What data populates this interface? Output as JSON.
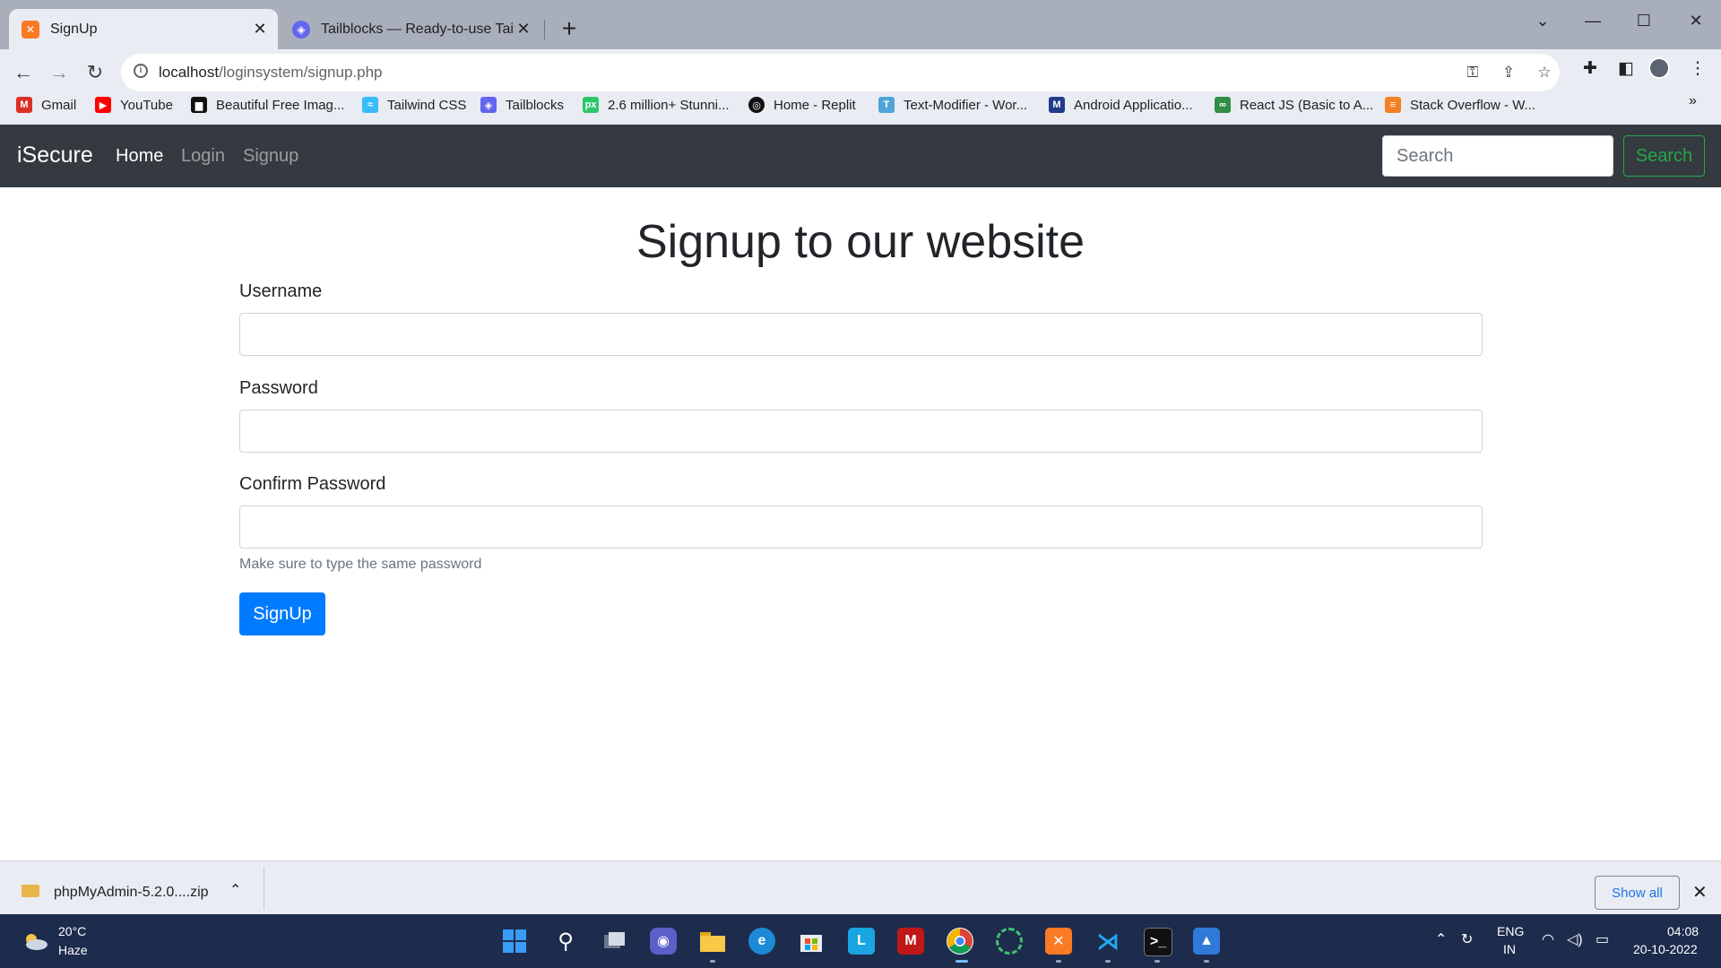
{
  "browser": {
    "tabs": [
      {
        "title": "SignUp",
        "active": true,
        "favicon": "xampp-icon"
      },
      {
        "title": "Tailblocks — Ready-to-use Tailwind",
        "active": false,
        "favicon": "tailblocks-icon"
      }
    ],
    "url_host": "localhost",
    "url_path": "/loginsystem/signup.php",
    "bookmarks": [
      {
        "label": "Gmail",
        "icon": "gmail-icon",
        "color": "#d93025"
      },
      {
        "label": "YouTube",
        "icon": "youtube-icon",
        "color": "#ff0000"
      },
      {
        "label": "Beautiful Free Imag...",
        "icon": "unsplash-icon",
        "color": "#111111"
      },
      {
        "label": "Tailwind CSS",
        "icon": "tailwind-icon",
        "color": "#38bdf8"
      },
      {
        "label": "Tailblocks",
        "icon": "tailblocks-icon",
        "color": "#6366f1"
      },
      {
        "label": "2.6 million+ Stunni...",
        "icon": "pixabay-icon",
        "color": "#2ec66d"
      },
      {
        "label": "Home - Replit",
        "icon": "replit-icon",
        "color": "#111111"
      },
      {
        "label": "Text-Modifier - Wor...",
        "icon": "text-modifier-icon",
        "color": "#4fa3d9"
      },
      {
        "label": "Android Applicatio...",
        "icon": "android-app-icon",
        "color": "#1f3c88"
      },
      {
        "label": "React JS (Basic to A...",
        "icon": "geeksforgeeks-icon",
        "color": "#2f8d46"
      },
      {
        "label": "Stack Overflow - W...",
        "icon": "stackoverflow-icon",
        "color": "#f48024"
      }
    ]
  },
  "navbar": {
    "brand": "iSecure",
    "links": [
      "Home",
      "Login",
      "Signup"
    ],
    "search_placeholder": "Search",
    "search_button": "Search"
  },
  "form": {
    "heading": "Signup to our website",
    "username_label": "Username",
    "password_label": "Password",
    "confirm_label": "Confirm Password",
    "help_text": "Make sure to type the same password",
    "submit": "SignUp"
  },
  "downloads": {
    "file": "phpMyAdmin-5.2.0....zip",
    "show_all": "Show all"
  },
  "taskbar": {
    "temperature": "20°C",
    "weather": "Haze",
    "lang": "ENG",
    "region": "IN",
    "time": "04:08",
    "date": "20-10-2022"
  },
  "colors": {
    "navbar_bg": "#343a40",
    "primary": "#007bff",
    "success": "#28a745",
    "taskbar_bg": "#1d2c4d"
  }
}
